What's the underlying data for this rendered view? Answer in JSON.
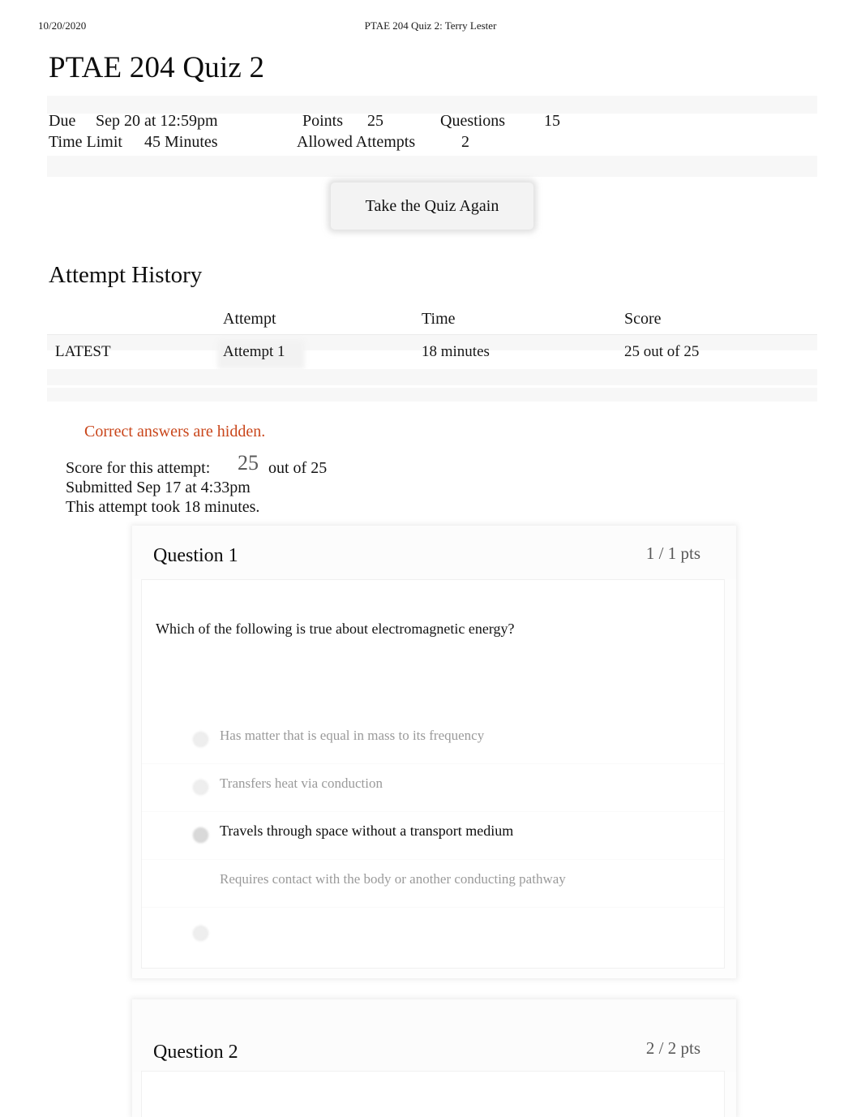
{
  "print_header": {
    "date": "10/20/2020",
    "document_title": "PTAE 204 Quiz 2: Terry Lester"
  },
  "page_title": "PTAE 204 Quiz 2",
  "quiz_meta": {
    "due_label": "Due",
    "due_value": "Sep 20 at 12:59pm",
    "points_label": "Points",
    "points_value": "25",
    "questions_label": "Questions",
    "questions_value": "15",
    "time_limit_label": "Time Limit",
    "time_limit_value": "45 Minutes",
    "allowed_attempts_label": "Allowed Attempts",
    "allowed_attempts_value": "2"
  },
  "retake_button_label": "Take the Quiz Again",
  "attempt_history": {
    "heading": "Attempt History",
    "columns": {
      "flag": "",
      "attempt": "Attempt",
      "time": "Time",
      "score": "Score"
    },
    "rows": [
      {
        "flag": "LATEST",
        "attempt": "Attempt 1",
        "time": "18 minutes",
        "score": "25 out of 25"
      }
    ]
  },
  "answers_hidden_notice": "Correct answers are hidden.",
  "attempt_summary": {
    "score_label": "Score for this attempt:",
    "score_value": "25",
    "score_outof": "out of 25",
    "submitted": "Submitted Sep 17 at 4:33pm",
    "duration": "This attempt took 18 minutes."
  },
  "questions": [
    {
      "title": "Question 1",
      "points": "1 / 1 pts",
      "text": "Which of the following is true about electromagnetic energy?",
      "answers": [
        {
          "text": "Has matter that is equal in mass to its frequency",
          "selected": false
        },
        {
          "text": "Transfers heat via conduction",
          "selected": false
        },
        {
          "text": "Travels through space without a transport medium",
          "selected": true
        },
        {
          "text": "Requires contact with the body or another conducting pathway",
          "selected": false
        },
        {
          "text": "",
          "selected": false
        }
      ]
    },
    {
      "title": "Question 2",
      "points": "2 / 2 pts",
      "text": "",
      "answers": []
    }
  ],
  "colors": {
    "notice_orange": "#c9461b",
    "body_text": "#141414",
    "muted_text": "#9a9a9a",
    "points_text": "#585858",
    "band_gray": "#f7f7f7"
  }
}
